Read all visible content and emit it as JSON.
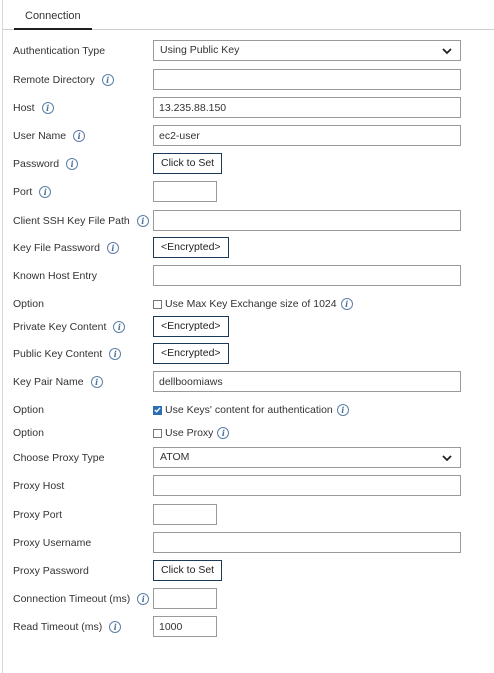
{
  "tabs": [
    {
      "label": "Connection"
    }
  ],
  "fields": {
    "auth_type": {
      "label": "Authentication Type",
      "value": "Using Public Key"
    },
    "remote_dir": {
      "label": "Remote Directory",
      "value": ""
    },
    "host": {
      "label": "Host",
      "value": "13.235.88.150"
    },
    "user_name": {
      "label": "User Name",
      "value": "ec2-user"
    },
    "password": {
      "label": "Password",
      "button": "Click to Set"
    },
    "port": {
      "label": "Port",
      "value": ""
    },
    "ssh_key_path": {
      "label": "Client SSH Key File Path",
      "value": ""
    },
    "key_file_password": {
      "label": "Key File Password",
      "button": "<Encrypted>"
    },
    "known_host": {
      "label": "Known Host Entry",
      "value": ""
    },
    "option_max_key": {
      "label": "Option",
      "text": "Use Max Key Exchange size of 1024",
      "checked": false
    },
    "private_key": {
      "label": "Private Key Content",
      "button": "<Encrypted>"
    },
    "public_key": {
      "label": "Public Key Content",
      "button": "<Encrypted>"
    },
    "key_pair_name": {
      "label": "Key Pair Name",
      "value": "dellboomiaws"
    },
    "option_keys_content": {
      "label": "Option",
      "text": "Use Keys' content for authentication",
      "checked": true
    },
    "option_proxy": {
      "label": "Option",
      "text": "Use Proxy",
      "checked": false
    },
    "proxy_type": {
      "label": "Choose Proxy Type",
      "value": "ATOM"
    },
    "proxy_host": {
      "label": "Proxy Host",
      "value": ""
    },
    "proxy_port": {
      "label": "Proxy Port",
      "value": ""
    },
    "proxy_username": {
      "label": "Proxy Username",
      "value": ""
    },
    "proxy_password": {
      "label": "Proxy Password",
      "button": "Click to Set"
    },
    "conn_timeout": {
      "label": "Connection Timeout (ms)",
      "value": ""
    },
    "read_timeout": {
      "label": "Read Timeout (ms)",
      "value": "1000"
    }
  },
  "icons": {
    "info": "info-icon",
    "dropdown": "chevron-down-icon",
    "check": "checkmark-icon"
  },
  "colors": {
    "button_border": "#1b3a57",
    "info_icon": "#4a6f9a",
    "checkbox_checked": "#2a6fb5"
  }
}
